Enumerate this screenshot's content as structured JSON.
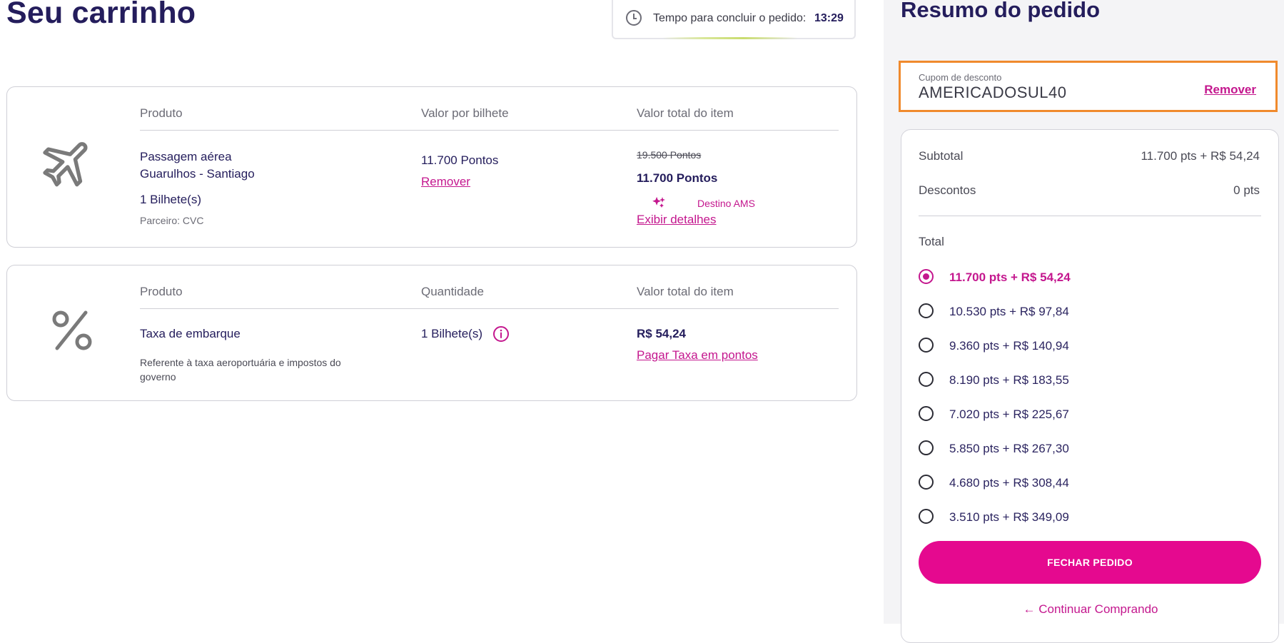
{
  "page": {
    "title": "Seu carrinho"
  },
  "timer": {
    "label": "Tempo para concluir o pedido:",
    "time": "13:29",
    "icon": "clock-icon"
  },
  "cart": {
    "flight": {
      "icon": "airplane-icon",
      "headers": {
        "product": "Produto",
        "unit": "Valor por bilhete",
        "total": "Valor total do item"
      },
      "product_line1": "Passagem aérea",
      "product_line2": "Guarulhos - Santiago",
      "tickets": "1 Bilhete(s)",
      "partner": "Parceiro: CVC",
      "unit_value": "11.700 Pontos",
      "remove": "Remover",
      "old_total": "19.500 Pontos",
      "total": "11.700 Pontos",
      "promo_icon": "sparkle-icon",
      "promo": "Destino AMS",
      "details": "Exibir detalhes"
    },
    "tax": {
      "icon": "percent-icon",
      "headers": {
        "product": "Produto",
        "qty": "Quantidade",
        "total": "Valor total do item"
      },
      "name": "Taxa de embarque",
      "desc_line1": "Referente à taxa aeroportuária e impostos do",
      "desc_line2": "governo",
      "qty": "1 Bilhete(s)",
      "info_icon": "info-icon",
      "total": "R$ 54,24",
      "pay_points": "Pagar Taxa em pontos"
    }
  },
  "summary": {
    "title": "Resumo do pedido",
    "coupon": {
      "label": "Cupom de desconto",
      "code": "AMERICADOSUL40",
      "remove": "Remover"
    },
    "subtotal_label": "Subtotal",
    "subtotal_value": "11.700 pts + R$ 54,24",
    "discount_label": "Descontos",
    "discount_value": "0 pts",
    "total_label": "Total",
    "options": [
      {
        "label": "11.700 pts + R$ 54,24",
        "selected": true
      },
      {
        "label": "10.530 pts + R$ 97,84",
        "selected": false
      },
      {
        "label": "9.360 pts + R$ 140,94",
        "selected": false
      },
      {
        "label": "8.190 pts + R$ 183,55",
        "selected": false
      },
      {
        "label": "7.020 pts + R$ 225,67",
        "selected": false
      },
      {
        "label": "5.850 pts + R$ 267,30",
        "selected": false
      },
      {
        "label": "4.680 pts + R$ 308,44",
        "selected": false
      },
      {
        "label": "3.510 pts + R$ 349,09",
        "selected": false
      }
    ],
    "checkout_button": "FECHAR PEDIDO",
    "continue": "Continuar Comprando",
    "continue_icon": "arrow-left-icon"
  },
  "colors": {
    "brand": "#e5098f",
    "accent_text": "#c4178e",
    "navy": "#241d5c",
    "highlight_border": "#f08a2d"
  }
}
